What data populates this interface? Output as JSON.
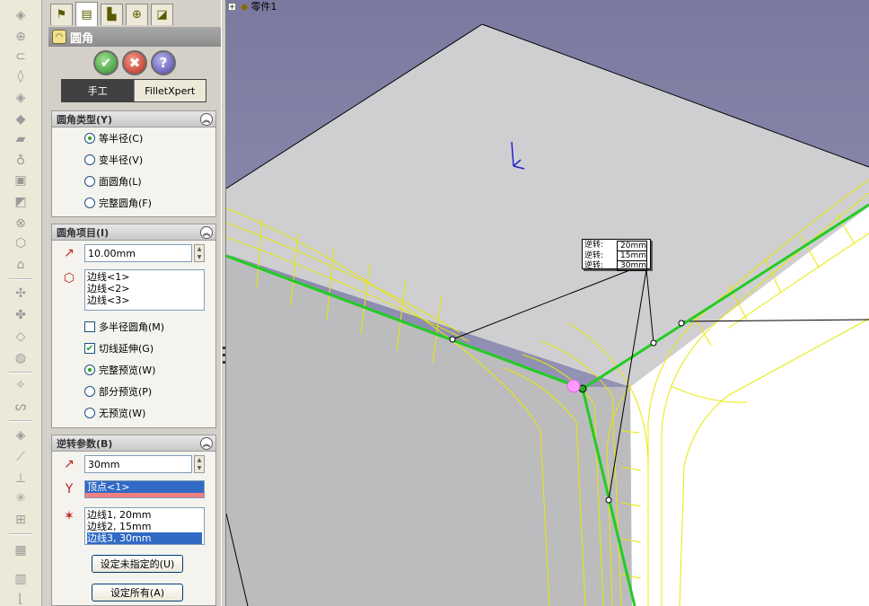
{
  "viewport": {
    "tree_part_label": "零件1",
    "callout_rows": [
      {
        "label": "逆转:",
        "value": "20mm"
      },
      {
        "label": "逆转:",
        "value": "15mm"
      },
      {
        "label": "逆转:",
        "value": "30mm"
      }
    ]
  },
  "pm": {
    "title": "圆角",
    "mode_manual": "手工",
    "mode_xpert": "FilletXpert",
    "fillet_type": {
      "header": "圆角类型(Y)",
      "options": [
        "等半径(C)",
        "变半径(V)",
        "面圆角(L)",
        "完整圆角(F)"
      ]
    },
    "fillet_items": {
      "header": "圆角项目(I)",
      "radius": "10.00mm",
      "edges": [
        "边线<1>",
        "边线<2>",
        "边线<3>"
      ],
      "multi_radius": "多半径圆角(M)",
      "tangent": "切线延伸(G)",
      "preview_full": "完整预览(W)",
      "preview_partial": "部分预览(P)",
      "preview_none": "无预览(W)"
    },
    "setback": {
      "header": "逆转参数(B)",
      "distance": "30mm",
      "vertex": "顶点<1>",
      "edges": [
        "边线1, 20mm",
        "边线2, 15mm",
        "边线3, 30mm"
      ],
      "set_unassigned": "设定未指定的(U)",
      "set_all": "设定所有(A)"
    }
  }
}
